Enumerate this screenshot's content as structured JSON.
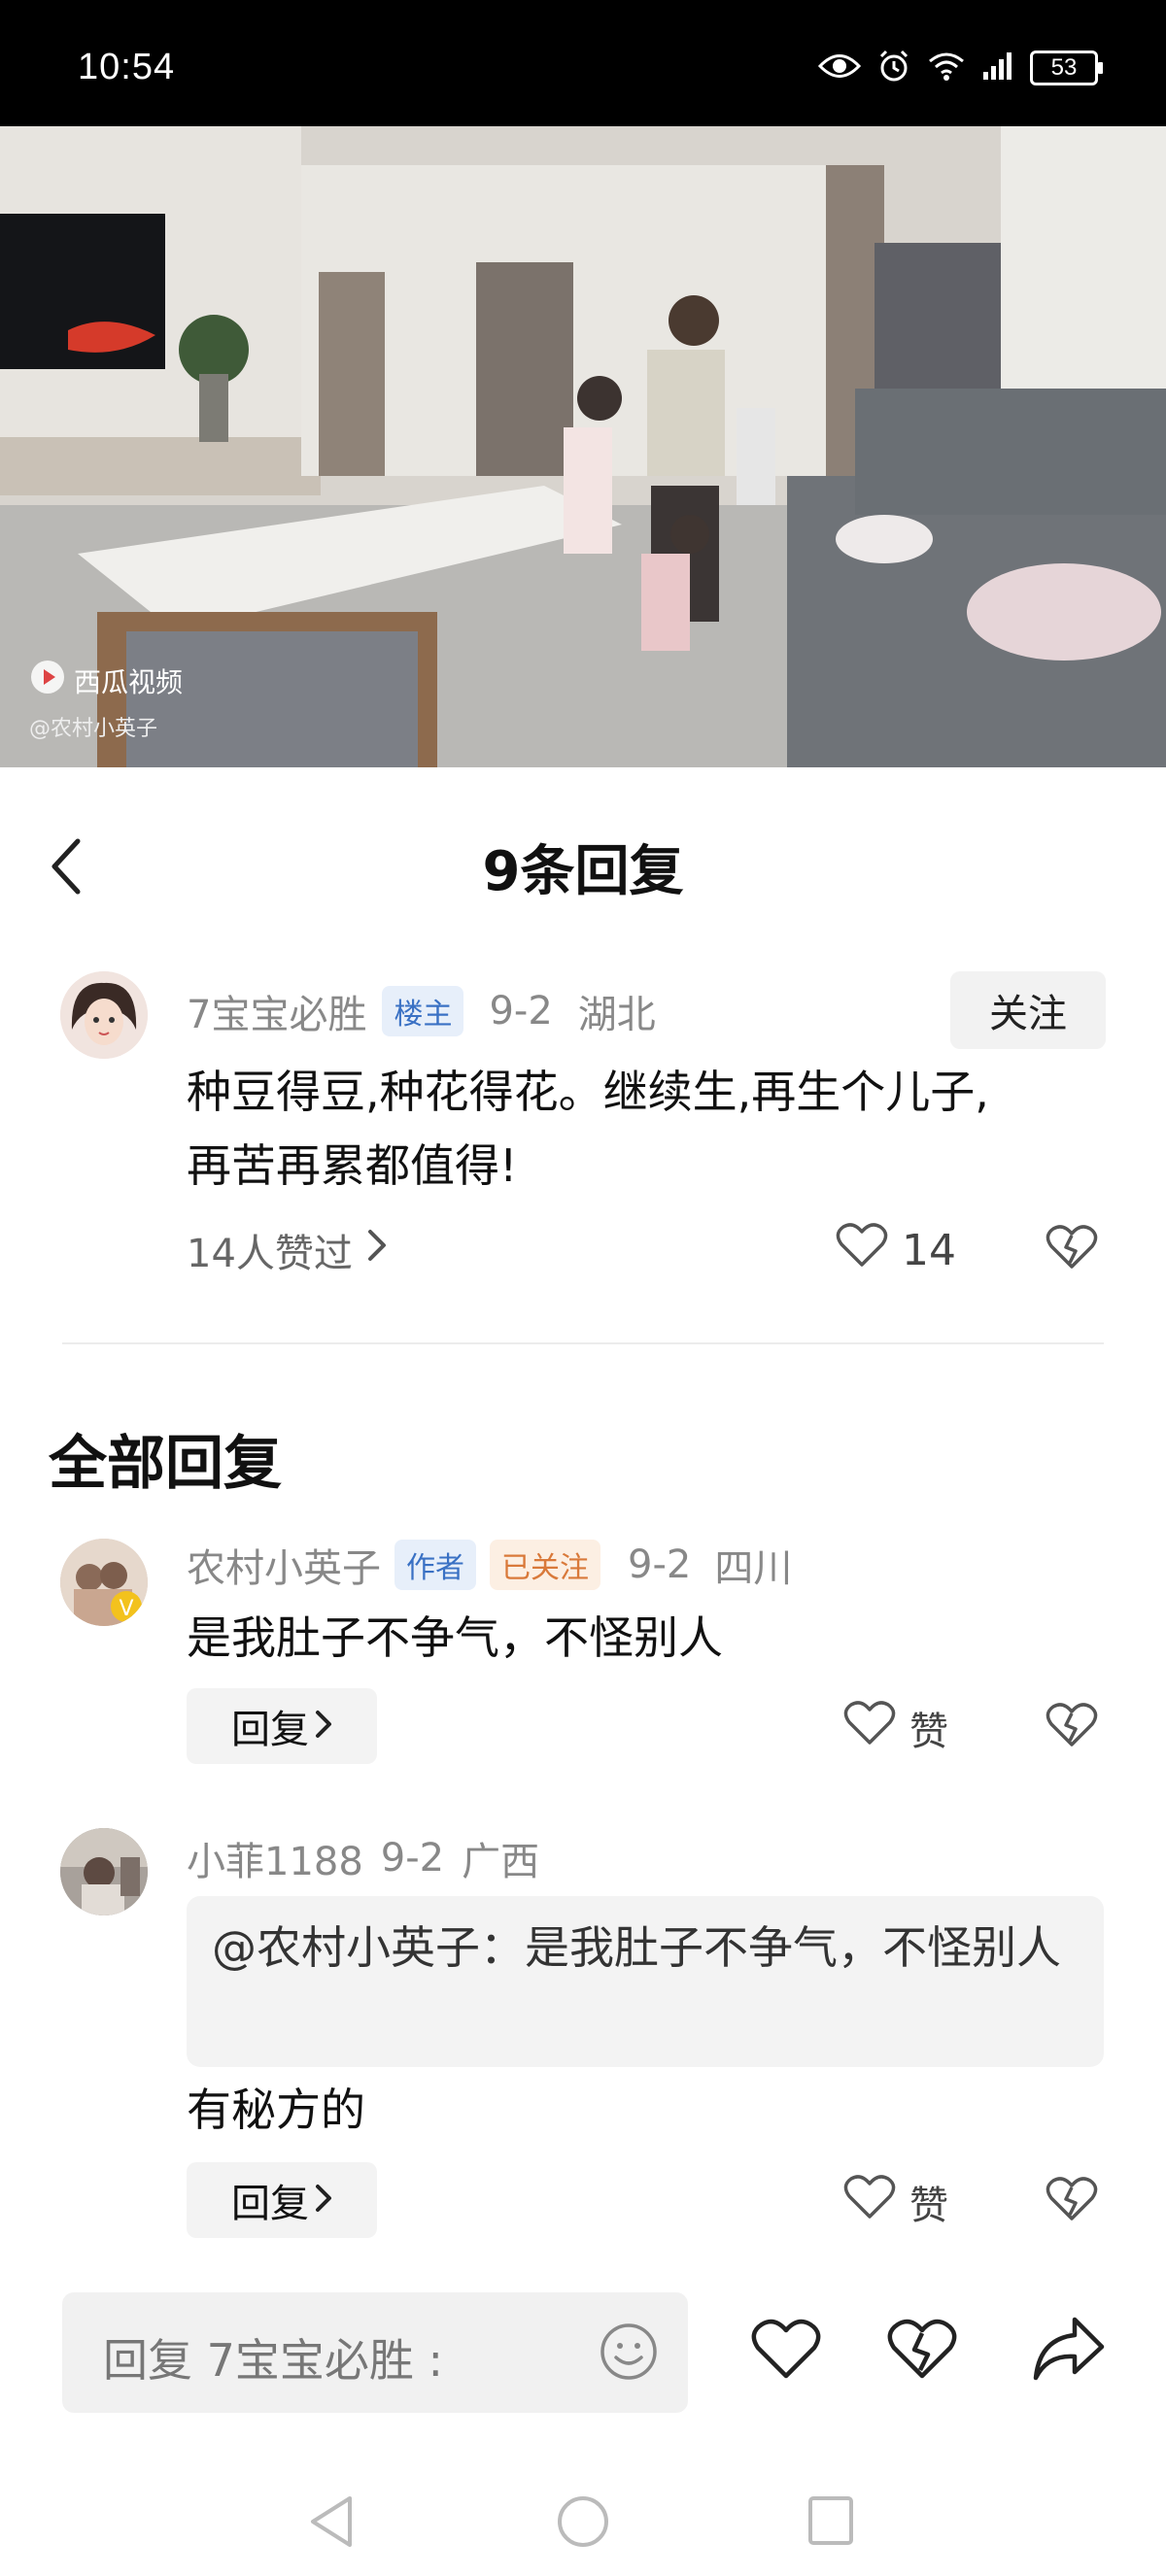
{
  "status_bar": {
    "time": "10:54",
    "battery": "53"
  },
  "video": {
    "watermark": "西瓜视频",
    "handle": "@农村小英子"
  },
  "header": {
    "title": "9条回复"
  },
  "main_comment": {
    "username": "7宝宝必胜",
    "badge": "楼主",
    "date": "9-2",
    "location": "湖北",
    "follow_label": "关注",
    "text_line1": "种豆得豆,种花得花。继续生,再生个儿子,",
    "text_line2": "再苦再累都值得!",
    "likes_summary": "14人赞过",
    "like_count": "14"
  },
  "section": {
    "title": "全部回复"
  },
  "replies": [
    {
      "username": "农村小英子",
      "badge_author": "作者",
      "badge_followed": "已关注",
      "date": "9-2",
      "location": "四川",
      "text": "是我肚子不争气，不怪别人",
      "reply_label": "回复",
      "like_label": "赞"
    },
    {
      "username": "小菲1188",
      "date": "9-2",
      "location": "广西",
      "quote": "@农村小英子：是我肚子不争气，不怪别人",
      "text": "有秘方的",
      "reply_label": "回复",
      "like_label": "赞"
    }
  ],
  "input": {
    "placeholder": "回复 7宝宝必胜 :"
  },
  "colors": {
    "blue_badge": "#3a71c4",
    "orange_badge": "#d9793a",
    "sheet_bg": "#ffffff",
    "status_bg": "#000000"
  }
}
